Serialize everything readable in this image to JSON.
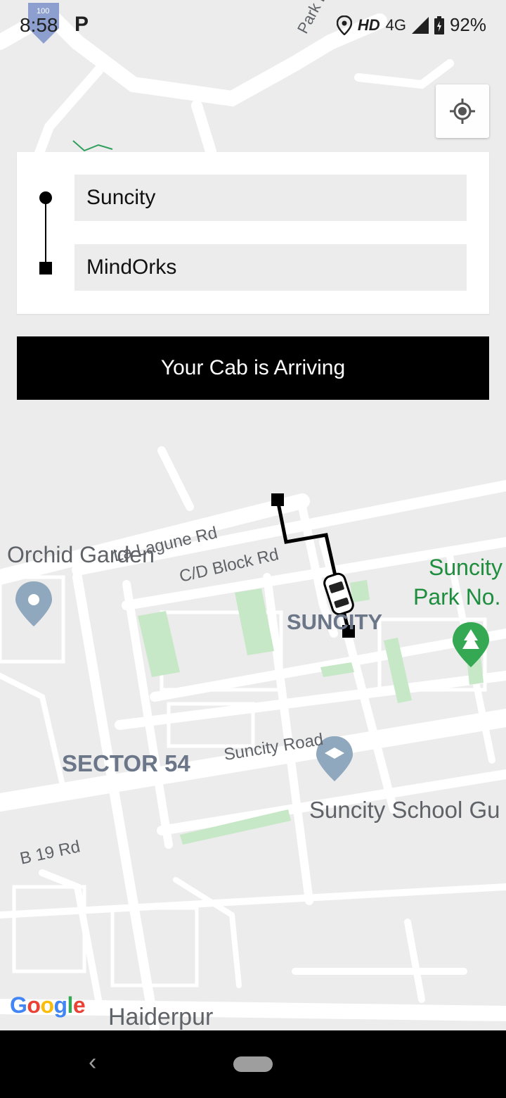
{
  "status_bar": {
    "time": "8:58",
    "parking_indicator": "P",
    "hd_label": "HD",
    "network_label": "4G",
    "battery_percent": "92%",
    "icons": [
      "location-icon",
      "signal-icon",
      "battery-charging-icon"
    ]
  },
  "route": {
    "pickup_value": "Suncity",
    "drop_value": "MindOrks"
  },
  "banner": {
    "text": "Your Cab is Arriving"
  },
  "map": {
    "labels": {
      "park_dr": "Park Dr",
      "la_lagune_rd": "La Lagune Rd",
      "cd_block_rd": "C/D Block Rd",
      "orchid_garden": "Orchid Garden",
      "suncity_area": "SUNCITY",
      "suncity_park_line1": "Suncity",
      "suncity_park_line2": "Park No.",
      "sector_54": "SECTOR 54",
      "suncity_road": "Suncity Road",
      "suncity_school": "Suncity School Gu",
      "b19_rd": "B 19 Rd",
      "haiderpur": "Haiderpur",
      "road_marker": "100"
    },
    "google_logo": [
      "G",
      "o",
      "o",
      "g",
      "l",
      "e"
    ],
    "colors": {
      "background": "#ececec",
      "road": "#ffffff",
      "park": "#c6e8c6",
      "area_label": "#6b7789",
      "green_label": "#1e8e3e",
      "route_path": "#000000"
    }
  }
}
